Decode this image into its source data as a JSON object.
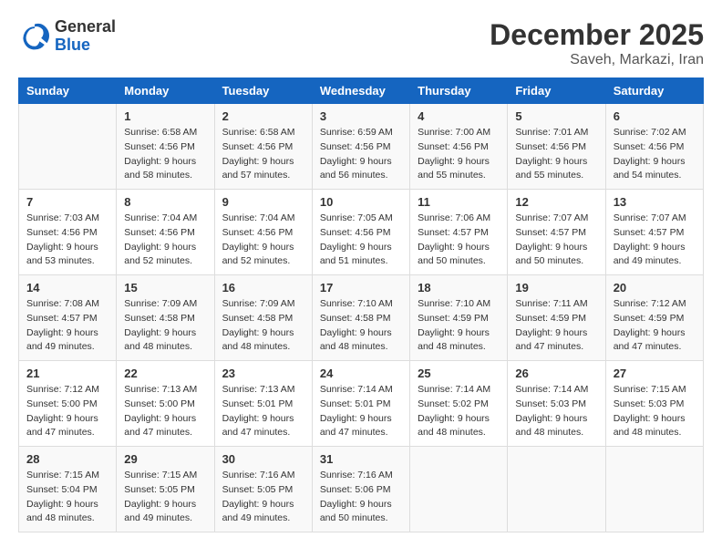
{
  "header": {
    "logo_general": "General",
    "logo_blue": "Blue",
    "month_year": "December 2025",
    "location": "Saveh, Markazi, Iran"
  },
  "days_of_week": [
    "Sunday",
    "Monday",
    "Tuesday",
    "Wednesday",
    "Thursday",
    "Friday",
    "Saturday"
  ],
  "weeks": [
    [
      {
        "day": "",
        "info": ""
      },
      {
        "day": "1",
        "info": "Sunrise: 6:58 AM\nSunset: 4:56 PM\nDaylight: 9 hours\nand 58 minutes."
      },
      {
        "day": "2",
        "info": "Sunrise: 6:58 AM\nSunset: 4:56 PM\nDaylight: 9 hours\nand 57 minutes."
      },
      {
        "day": "3",
        "info": "Sunrise: 6:59 AM\nSunset: 4:56 PM\nDaylight: 9 hours\nand 56 minutes."
      },
      {
        "day": "4",
        "info": "Sunrise: 7:00 AM\nSunset: 4:56 PM\nDaylight: 9 hours\nand 55 minutes."
      },
      {
        "day": "5",
        "info": "Sunrise: 7:01 AM\nSunset: 4:56 PM\nDaylight: 9 hours\nand 55 minutes."
      },
      {
        "day": "6",
        "info": "Sunrise: 7:02 AM\nSunset: 4:56 PM\nDaylight: 9 hours\nand 54 minutes."
      }
    ],
    [
      {
        "day": "7",
        "info": "Sunrise: 7:03 AM\nSunset: 4:56 PM\nDaylight: 9 hours\nand 53 minutes."
      },
      {
        "day": "8",
        "info": "Sunrise: 7:04 AM\nSunset: 4:56 PM\nDaylight: 9 hours\nand 52 minutes."
      },
      {
        "day": "9",
        "info": "Sunrise: 7:04 AM\nSunset: 4:56 PM\nDaylight: 9 hours\nand 52 minutes."
      },
      {
        "day": "10",
        "info": "Sunrise: 7:05 AM\nSunset: 4:56 PM\nDaylight: 9 hours\nand 51 minutes."
      },
      {
        "day": "11",
        "info": "Sunrise: 7:06 AM\nSunset: 4:57 PM\nDaylight: 9 hours\nand 50 minutes."
      },
      {
        "day": "12",
        "info": "Sunrise: 7:07 AM\nSunset: 4:57 PM\nDaylight: 9 hours\nand 50 minutes."
      },
      {
        "day": "13",
        "info": "Sunrise: 7:07 AM\nSunset: 4:57 PM\nDaylight: 9 hours\nand 49 minutes."
      }
    ],
    [
      {
        "day": "14",
        "info": "Sunrise: 7:08 AM\nSunset: 4:57 PM\nDaylight: 9 hours\nand 49 minutes."
      },
      {
        "day": "15",
        "info": "Sunrise: 7:09 AM\nSunset: 4:58 PM\nDaylight: 9 hours\nand 48 minutes."
      },
      {
        "day": "16",
        "info": "Sunrise: 7:09 AM\nSunset: 4:58 PM\nDaylight: 9 hours\nand 48 minutes."
      },
      {
        "day": "17",
        "info": "Sunrise: 7:10 AM\nSunset: 4:58 PM\nDaylight: 9 hours\nand 48 minutes."
      },
      {
        "day": "18",
        "info": "Sunrise: 7:10 AM\nSunset: 4:59 PM\nDaylight: 9 hours\nand 48 minutes."
      },
      {
        "day": "19",
        "info": "Sunrise: 7:11 AM\nSunset: 4:59 PM\nDaylight: 9 hours\nand 47 minutes."
      },
      {
        "day": "20",
        "info": "Sunrise: 7:12 AM\nSunset: 4:59 PM\nDaylight: 9 hours\nand 47 minutes."
      }
    ],
    [
      {
        "day": "21",
        "info": "Sunrise: 7:12 AM\nSunset: 5:00 PM\nDaylight: 9 hours\nand 47 minutes."
      },
      {
        "day": "22",
        "info": "Sunrise: 7:13 AM\nSunset: 5:00 PM\nDaylight: 9 hours\nand 47 minutes."
      },
      {
        "day": "23",
        "info": "Sunrise: 7:13 AM\nSunset: 5:01 PM\nDaylight: 9 hours\nand 47 minutes."
      },
      {
        "day": "24",
        "info": "Sunrise: 7:14 AM\nSunset: 5:01 PM\nDaylight: 9 hours\nand 47 minutes."
      },
      {
        "day": "25",
        "info": "Sunrise: 7:14 AM\nSunset: 5:02 PM\nDaylight: 9 hours\nand 48 minutes."
      },
      {
        "day": "26",
        "info": "Sunrise: 7:14 AM\nSunset: 5:03 PM\nDaylight: 9 hours\nand 48 minutes."
      },
      {
        "day": "27",
        "info": "Sunrise: 7:15 AM\nSunset: 5:03 PM\nDaylight: 9 hours\nand 48 minutes."
      }
    ],
    [
      {
        "day": "28",
        "info": "Sunrise: 7:15 AM\nSunset: 5:04 PM\nDaylight: 9 hours\nand 48 minutes."
      },
      {
        "day": "29",
        "info": "Sunrise: 7:15 AM\nSunset: 5:05 PM\nDaylight: 9 hours\nand 49 minutes."
      },
      {
        "day": "30",
        "info": "Sunrise: 7:16 AM\nSunset: 5:05 PM\nDaylight: 9 hours\nand 49 minutes."
      },
      {
        "day": "31",
        "info": "Sunrise: 7:16 AM\nSunset: 5:06 PM\nDaylight: 9 hours\nand 50 minutes."
      },
      {
        "day": "",
        "info": ""
      },
      {
        "day": "",
        "info": ""
      },
      {
        "day": "",
        "info": ""
      }
    ]
  ]
}
